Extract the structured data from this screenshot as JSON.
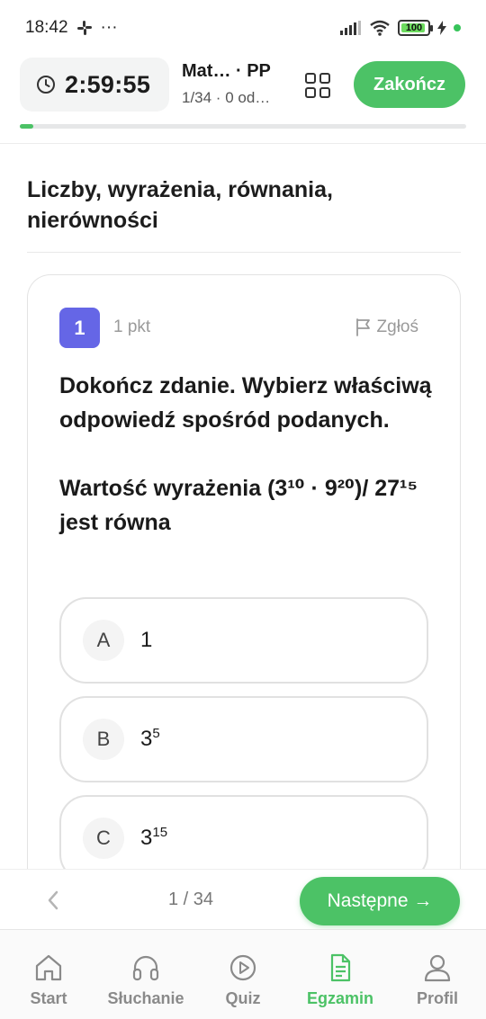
{
  "status_bar": {
    "time": "18:42",
    "battery": "100"
  },
  "header": {
    "timer": "2:59:55",
    "exam_title": "Mat… · PP",
    "exam_subtitle": "1/34 · 0 od…",
    "finish_label": "Zakończ",
    "progress_fraction": 0.0294
  },
  "section": {
    "title": "Liczby, wyrażenia, równania, nierówności"
  },
  "question": {
    "number": "1",
    "points": "1 pkt",
    "report_label": "Zgłoś",
    "instruction": "Dokończ zdanie. Wybierz właściwą odpowiedź spośród podanych.",
    "prompt": "Wartość wyrażenia (3¹⁰ · 9²⁰)/ 27¹⁵ jest równa",
    "options": [
      {
        "letter": "A",
        "base": "1",
        "exp": ""
      },
      {
        "letter": "B",
        "base": "3",
        "exp": "5"
      },
      {
        "letter": "C",
        "base": "3",
        "exp": "15"
      }
    ]
  },
  "pager": {
    "count": "1 / 34",
    "next_label": "Następne →"
  },
  "nav": {
    "items": [
      {
        "label": "Start",
        "icon": "home-icon",
        "active": false
      },
      {
        "label": "Słuchanie",
        "icon": "headphones-icon",
        "active": false
      },
      {
        "label": "Quiz",
        "icon": "play-circle-icon",
        "active": false
      },
      {
        "label": "Egzamin",
        "icon": "document-icon",
        "active": true
      },
      {
        "label": "Profil",
        "icon": "user-icon",
        "active": false
      }
    ]
  },
  "colors": {
    "accent": "#4cc266",
    "question_badge": "#6566e6"
  }
}
